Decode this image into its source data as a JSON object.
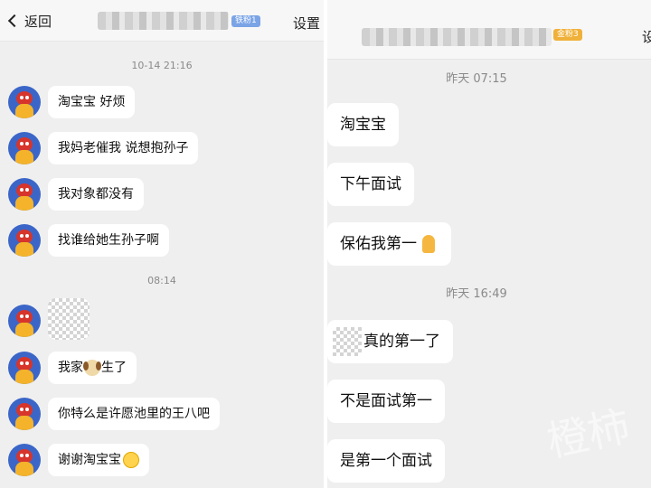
{
  "left": {
    "header": {
      "back_label": "返回",
      "badge": "铁粉1",
      "settings_label": "设置"
    },
    "groups": [
      {
        "time": "10-14 21:16",
        "messages": [
          "淘宝宝 好烦",
          "我妈老催我 说想抱孙子",
          "我对象都没有",
          "找谁给她生孙子啊"
        ]
      },
      {
        "time": "08:14",
        "messages": [
          "",
          "我家",
          "你特么是许愿池里的王八吧",
          "谢谢淘宝宝"
        ]
      }
    ],
    "msg_after_sticker": "生了"
  },
  "right": {
    "header": {
      "badge": "金粉3",
      "settings_label": "设"
    },
    "groups": [
      {
        "time": "昨天 07:15",
        "messages": [
          "淘宝宝",
          "下午面试",
          "保佑我第一"
        ]
      },
      {
        "time": "昨天 16:49",
        "messages": [
          "真的第一了",
          "不是面试第一",
          "是第一个面试"
        ]
      }
    ],
    "watermark": "橙柿"
  },
  "colors": {
    "badge_blue": "#7aa4e6",
    "badge_gold": "#f0b13a",
    "avatar_bg": "#3b66c8",
    "bubble_bg": "#ffffff",
    "chat_bg": "#efefef"
  },
  "icons": {
    "back": "chevron-left-icon",
    "sticker": "dog-sticker-icon",
    "smile": "smiling-emoji-icon",
    "pray": "praying-hands-emoji-icon"
  }
}
